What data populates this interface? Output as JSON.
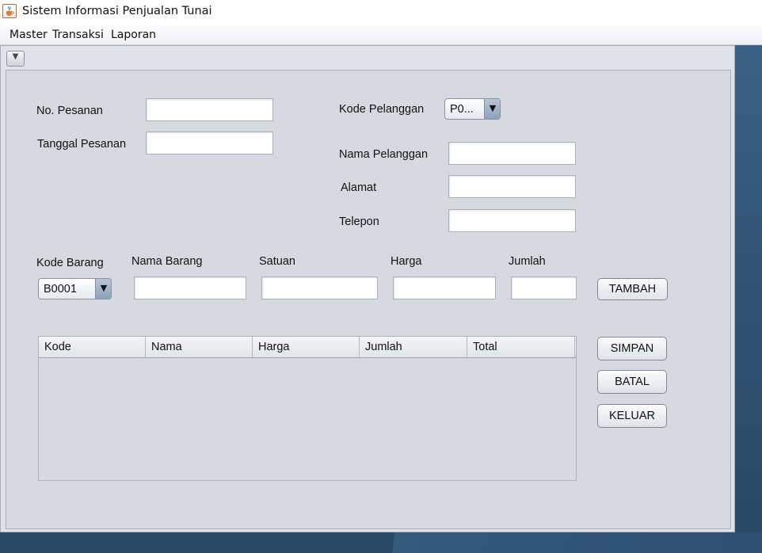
{
  "window": {
    "title": "Sistem Informasi Penjualan Tunai",
    "app_icon": "java-cup-icon"
  },
  "menubar": {
    "items": [
      "Master",
      "Transaksi",
      "Laporan"
    ]
  },
  "internal_frame": {
    "toggle_icon": "chevron-down-icon",
    "toggle_glyph": "▼"
  },
  "form": {
    "no_pesanan": {
      "label": "No. Pesanan",
      "value": ""
    },
    "tanggal_pesanan": {
      "label": "Tanggal Pesanan",
      "value": ""
    },
    "kode_pelanggan": {
      "label": "Kode Pelanggan",
      "selected": "P0..."
    },
    "nama_pelanggan": {
      "label": "Nama Pelanggan",
      "value": ""
    },
    "alamat": {
      "label": "Alamat",
      "value": ""
    },
    "telepon": {
      "label": "Telepon",
      "value": ""
    },
    "kode_barang": {
      "label": "Kode Barang",
      "selected": "B0001"
    },
    "nama_barang": {
      "label": "Nama Barang",
      "value": ""
    },
    "satuan": {
      "label": "Satuan",
      "value": ""
    },
    "harga": {
      "label": "Harga",
      "value": ""
    },
    "jumlah": {
      "label": "Jumlah",
      "value": ""
    },
    "combo_arrow": "▼"
  },
  "buttons": {
    "tambah": "TAMBAH",
    "simpan": "SIMPAN",
    "batal": "BATAL",
    "keluar": "KELUAR"
  },
  "table": {
    "columns": [
      "Kode",
      "Nama",
      "Harga",
      "Jumlah",
      "Total"
    ],
    "rows": []
  }
}
